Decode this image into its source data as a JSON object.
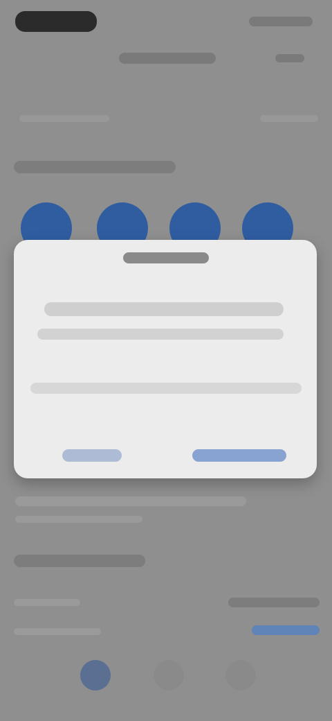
{
  "screen": {
    "blurred": true,
    "colors": {
      "background": "#8f8f8f",
      "accent": "#2f5da0",
      "modal": "#ececec",
      "modal_button": "#88a3d2"
    }
  },
  "status_bar": {
    "left_text": "",
    "right_text": ""
  },
  "header": {
    "title": "",
    "action": ""
  },
  "top_row": {
    "label": "",
    "value": ""
  },
  "section_1": {
    "title": "",
    "items": [
      {
        "label": ""
      },
      {
        "label": ""
      },
      {
        "label": ""
      },
      {
        "label": ""
      }
    ]
  },
  "modal": {
    "title": "",
    "message": "",
    "secondary_message": "",
    "cancel_label": "",
    "confirm_label": ""
  },
  "lower_text": {
    "line1": "",
    "line2": ""
  },
  "section_2": {
    "title": "",
    "rows": [
      {
        "label": "",
        "value": ""
      },
      {
        "label": "",
        "value": ""
      }
    ]
  },
  "tab_bar": {
    "tabs": [
      {
        "icon": "home-icon",
        "selected": true,
        "label": ""
      },
      {
        "icon": "search-icon",
        "selected": false,
        "label": ""
      },
      {
        "icon": "profile-icon",
        "selected": false,
        "label": ""
      }
    ]
  }
}
